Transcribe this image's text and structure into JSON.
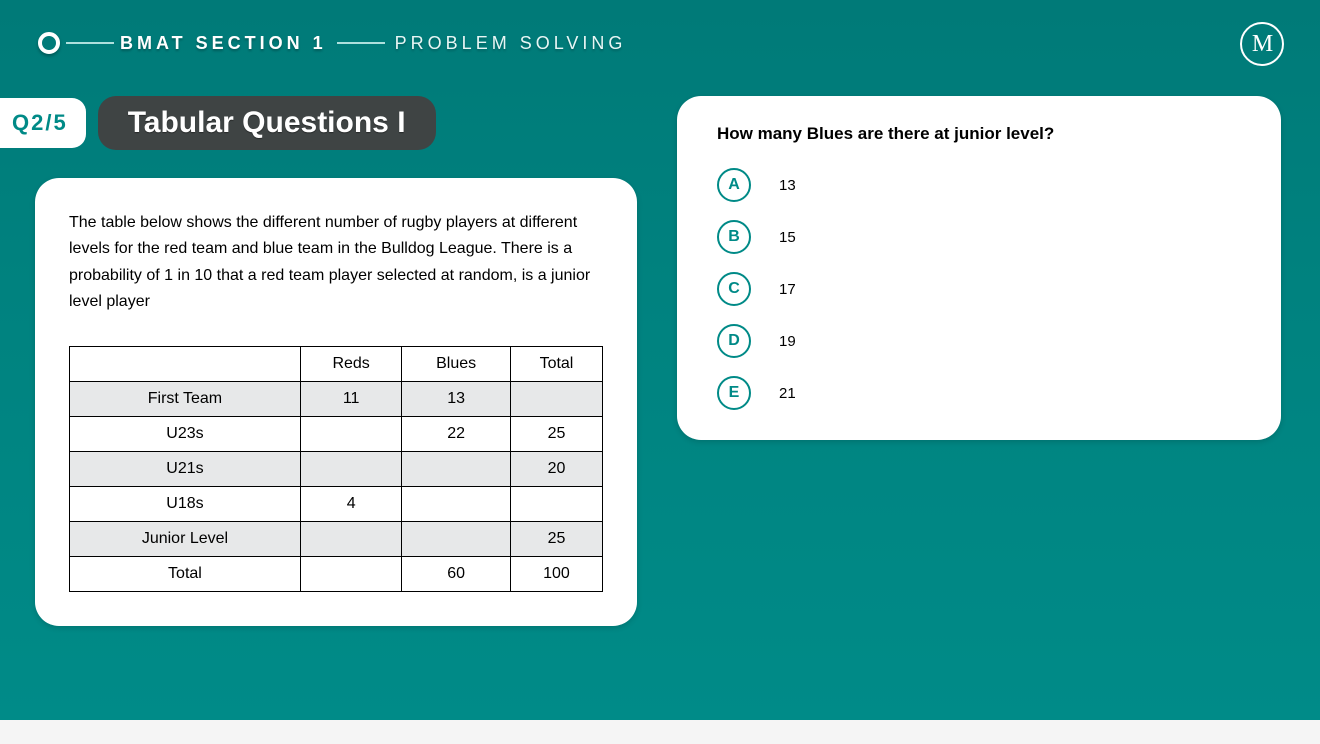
{
  "header": {
    "section": "BMAT SECTION 1",
    "topic": "PROBLEM SOLVING"
  },
  "qlabel": "Q2/5",
  "pill_title": "Tabular Questions I",
  "logo_letter": "M",
  "prompt_text": "The table below shows the different number of rugby players at different levels for the red team and blue team in the Bulldog League. There is a probability of 1 in 10 that a red team player selected at random, is a junior level player",
  "table": {
    "headers": [
      "",
      "Reds",
      "Blues",
      "Total"
    ],
    "rows": [
      {
        "label": "First Team",
        "reds": "11",
        "blues": "13",
        "total": "",
        "shaded": true
      },
      {
        "label": "U23s",
        "reds": "",
        "blues": "22",
        "total": "25",
        "shaded": false
      },
      {
        "label": "U21s",
        "reds": "",
        "blues": "",
        "total": "20",
        "shaded": true
      },
      {
        "label": "U18s",
        "reds": "4",
        "blues": "",
        "total": "",
        "shaded": false
      },
      {
        "label": "Junior Level",
        "reds": "",
        "blues": "",
        "total": "25",
        "shaded": true
      },
      {
        "label": "Total",
        "reds": "",
        "blues": "60",
        "total": "100",
        "shaded": false
      }
    ]
  },
  "question": "How many Blues are there at junior level?",
  "options": [
    {
      "letter": "A",
      "text": "13"
    },
    {
      "letter": "B",
      "text": "15"
    },
    {
      "letter": "C",
      "text": "17"
    },
    {
      "letter": "D",
      "text": "19"
    },
    {
      "letter": "E",
      "text": "21"
    }
  ]
}
